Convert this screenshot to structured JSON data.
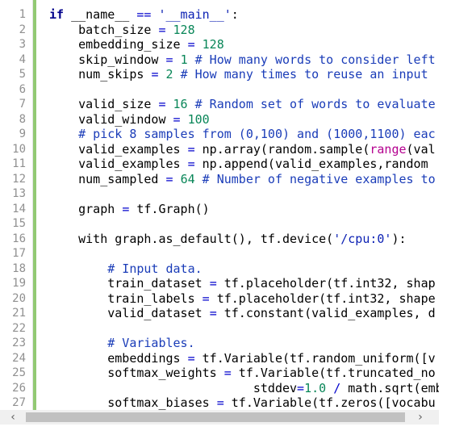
{
  "editor": {
    "language": "python",
    "lines": [
      {
        "n": "1",
        "tokens": [
          {
            "t": "kw",
            "v": "if"
          },
          {
            "t": "",
            "v": " __name__ "
          },
          {
            "t": "op",
            "v": "=="
          },
          {
            "t": "",
            "v": " "
          },
          {
            "t": "str",
            "v": "'__main__'"
          },
          {
            "t": "",
            "v": ":"
          }
        ]
      },
      {
        "n": "2",
        "tokens": [
          {
            "t": "",
            "v": "    batch_size "
          },
          {
            "t": "op",
            "v": "="
          },
          {
            "t": "",
            "v": " "
          },
          {
            "t": "num",
            "v": "128"
          }
        ]
      },
      {
        "n": "3",
        "tokens": [
          {
            "t": "",
            "v": "    embedding_size "
          },
          {
            "t": "op",
            "v": "="
          },
          {
            "t": "",
            "v": " "
          },
          {
            "t": "num",
            "v": "128"
          }
        ]
      },
      {
        "n": "4",
        "tokens": [
          {
            "t": "",
            "v": "    skip_window "
          },
          {
            "t": "op",
            "v": "="
          },
          {
            "t": "",
            "v": " "
          },
          {
            "t": "num",
            "v": "1"
          },
          {
            "t": "",
            "v": " "
          },
          {
            "t": "cm",
            "v": "# How many words to consider left"
          }
        ]
      },
      {
        "n": "5",
        "tokens": [
          {
            "t": "",
            "v": "    num_skips "
          },
          {
            "t": "op",
            "v": "="
          },
          {
            "t": "",
            "v": " "
          },
          {
            "t": "num",
            "v": "2"
          },
          {
            "t": "",
            "v": " "
          },
          {
            "t": "cm",
            "v": "# How many times to reuse an input"
          }
        ]
      },
      {
        "n": "6",
        "tokens": []
      },
      {
        "n": "7",
        "tokens": [
          {
            "t": "",
            "v": "    valid_size "
          },
          {
            "t": "op",
            "v": "="
          },
          {
            "t": "",
            "v": " "
          },
          {
            "t": "num",
            "v": "16"
          },
          {
            "t": "",
            "v": " "
          },
          {
            "t": "cm",
            "v": "# Random set of words to evaluate"
          }
        ]
      },
      {
        "n": "8",
        "tokens": [
          {
            "t": "",
            "v": "    valid_window "
          },
          {
            "t": "op",
            "v": "="
          },
          {
            "t": "",
            "v": " "
          },
          {
            "t": "num",
            "v": "100"
          }
        ]
      },
      {
        "n": "9",
        "tokens": [
          {
            "t": "",
            "v": "    "
          },
          {
            "t": "cm",
            "v": "# pick 8 samples from (0,100) and (1000,1100) eac"
          }
        ]
      },
      {
        "n": "10",
        "tokens": [
          {
            "t": "",
            "v": "    valid_examples "
          },
          {
            "t": "op",
            "v": "="
          },
          {
            "t": "",
            "v": " np.array(random.sample("
          },
          {
            "t": "bi",
            "v": "range"
          },
          {
            "t": "",
            "v": "(val"
          }
        ]
      },
      {
        "n": "11",
        "tokens": [
          {
            "t": "",
            "v": "    valid_examples "
          },
          {
            "t": "op",
            "v": "="
          },
          {
            "t": "",
            "v": " np.append(valid_examples,random"
          }
        ]
      },
      {
        "n": "12",
        "tokens": [
          {
            "t": "",
            "v": "    num_sampled "
          },
          {
            "t": "op",
            "v": "="
          },
          {
            "t": "",
            "v": " "
          },
          {
            "t": "num",
            "v": "64"
          },
          {
            "t": "",
            "v": " "
          },
          {
            "t": "cm",
            "v": "# Number of negative examples to"
          }
        ]
      },
      {
        "n": "13",
        "tokens": []
      },
      {
        "n": "14",
        "tokens": [
          {
            "t": "",
            "v": "    graph "
          },
          {
            "t": "op",
            "v": "="
          },
          {
            "t": "",
            "v": " tf.Graph()"
          }
        ]
      },
      {
        "n": "15",
        "tokens": []
      },
      {
        "n": "16",
        "tokens": [
          {
            "t": "",
            "v": "    with graph.as_default(), tf.device("
          },
          {
            "t": "str",
            "v": "'/cpu:0'"
          },
          {
            "t": "",
            "v": "):"
          }
        ]
      },
      {
        "n": "17",
        "tokens": []
      },
      {
        "n": "18",
        "tokens": [
          {
            "t": "",
            "v": "        "
          },
          {
            "t": "cm",
            "v": "# Input data."
          }
        ]
      },
      {
        "n": "19",
        "tokens": [
          {
            "t": "",
            "v": "        train_dataset "
          },
          {
            "t": "op",
            "v": "="
          },
          {
            "t": "",
            "v": " tf.placeholder(tf.int32, shap"
          }
        ]
      },
      {
        "n": "20",
        "tokens": [
          {
            "t": "",
            "v": "        train_labels "
          },
          {
            "t": "op",
            "v": "="
          },
          {
            "t": "",
            "v": " tf.placeholder(tf.int32, shape"
          }
        ]
      },
      {
        "n": "21",
        "tokens": [
          {
            "t": "",
            "v": "        valid_dataset "
          },
          {
            "t": "op",
            "v": "="
          },
          {
            "t": "",
            "v": " tf.constant(valid_examples, d"
          }
        ]
      },
      {
        "n": "22",
        "tokens": []
      },
      {
        "n": "23",
        "tokens": [
          {
            "t": "",
            "v": "        "
          },
          {
            "t": "cm",
            "v": "# Variables."
          }
        ]
      },
      {
        "n": "24",
        "tokens": [
          {
            "t": "",
            "v": "        embeddings "
          },
          {
            "t": "op",
            "v": "="
          },
          {
            "t": "",
            "v": " tf.Variable(tf.random_uniform([v"
          }
        ]
      },
      {
        "n": "25",
        "tokens": [
          {
            "t": "",
            "v": "        softmax_weights "
          },
          {
            "t": "op",
            "v": "="
          },
          {
            "t": "",
            "v": " tf.Variable(tf.truncated_no"
          }
        ]
      },
      {
        "n": "26",
        "tokens": [
          {
            "t": "",
            "v": "                            stddev"
          },
          {
            "t": "op",
            "v": "="
          },
          {
            "t": "num",
            "v": "1.0"
          },
          {
            "t": "",
            "v": " "
          },
          {
            "t": "op",
            "v": "/"
          },
          {
            "t": "",
            "v": " math.sqrt(embed"
          }
        ]
      },
      {
        "n": "27",
        "tokens": [
          {
            "t": "",
            "v": "        softmax_biases "
          },
          {
            "t": "op",
            "v": "="
          },
          {
            "t": "",
            "v": " tf.Variable(tf.zeros([vocabu"
          }
        ]
      }
    ]
  },
  "scrollbar": {
    "left_arrow": "‹",
    "right_arrow": "›"
  }
}
